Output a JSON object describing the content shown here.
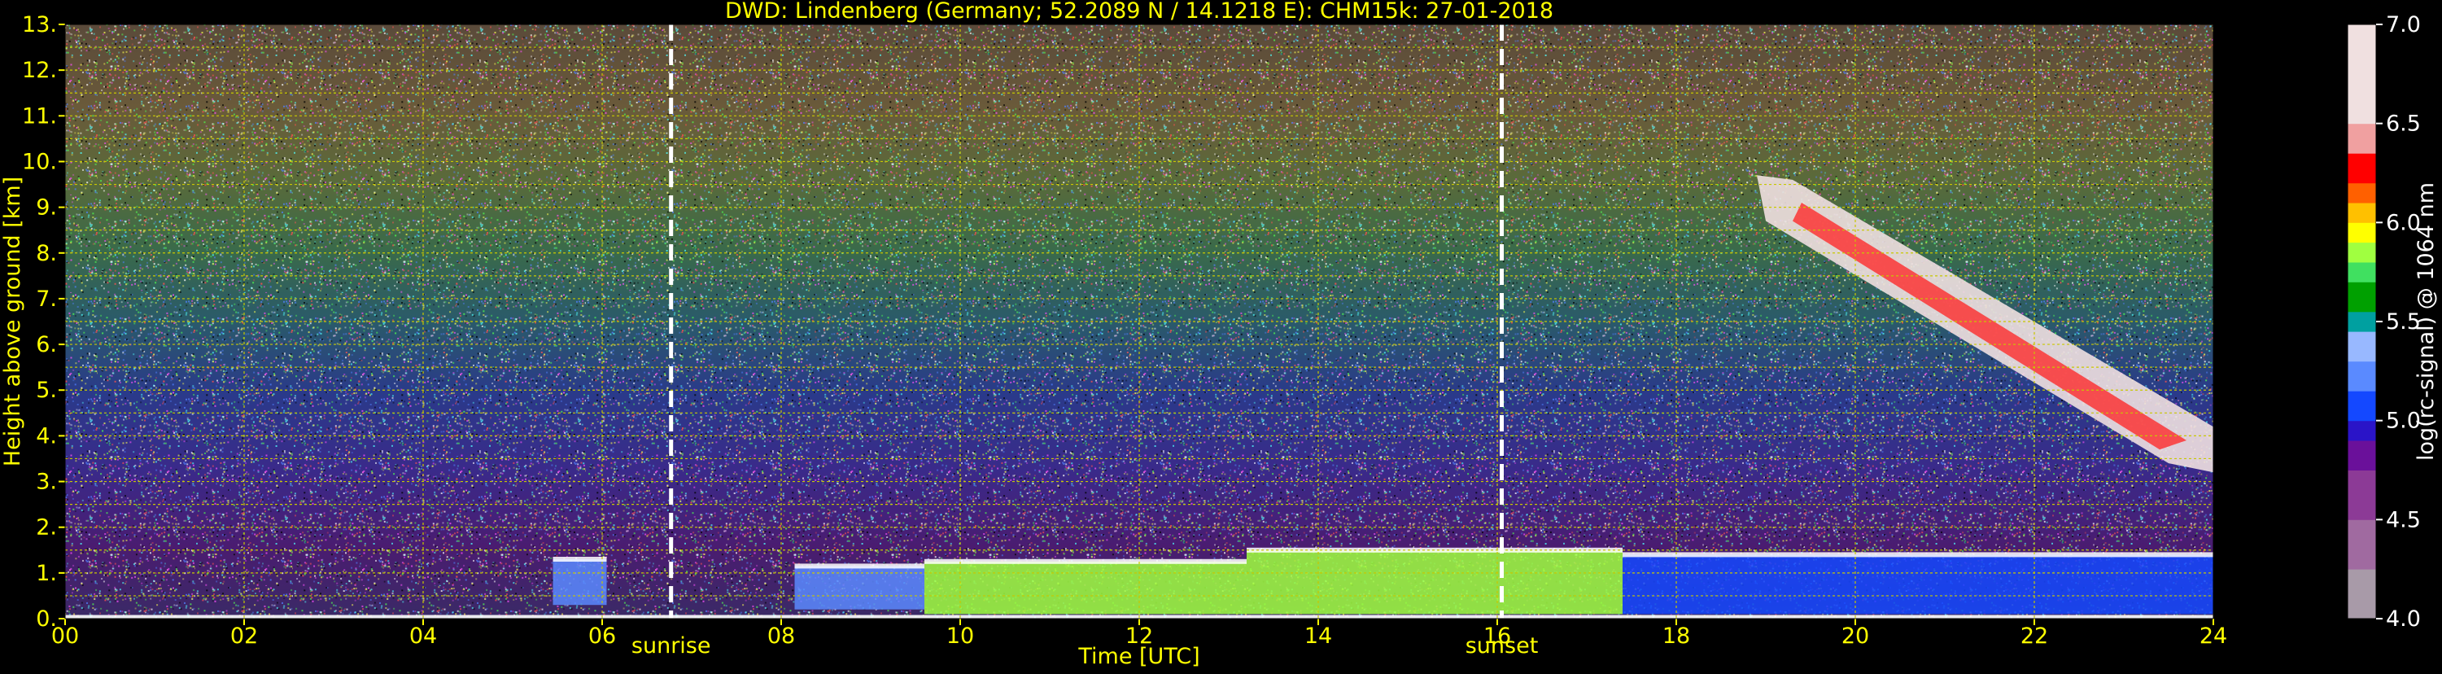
{
  "chart_data": {
    "type": "heatmap",
    "title": "DWD: Lindenberg (Germany; 52.2089 N / 14.1218 E):    CHM15k: 27-01-2018",
    "xlabel": "Time [UTC]",
    "ylabel": "Height above ground [km]",
    "colorbar_label": "log(rc-signal) @ 1064 nm",
    "xlim": [
      0,
      24
    ],
    "ylim": [
      0,
      13
    ],
    "clim": [
      4.0,
      7.0
    ],
    "x_ticks": [
      0,
      2,
      4,
      6,
      8,
      10,
      12,
      14,
      16,
      18,
      20,
      22,
      24
    ],
    "x_tick_labels": [
      "00",
      "02",
      "04",
      "06",
      "08",
      "10",
      "12",
      "14",
      "16",
      "18",
      "20",
      "22",
      "24"
    ],
    "y_ticks": [
      0,
      1,
      2,
      3,
      4,
      5,
      6,
      7,
      8,
      9,
      10,
      11,
      12,
      13
    ],
    "y_tick_labels": [
      "0.",
      "1.",
      "2.",
      "3.",
      "4.",
      "5.",
      "6.",
      "7.",
      "8.",
      "9.",
      "10.",
      "11.",
      "12.",
      "13."
    ],
    "colorbar_ticks": [
      4.0,
      4.5,
      5.0,
      5.5,
      6.0,
      6.5,
      7.0
    ],
    "colorbar_tick_labels": [
      "4.0",
      "4.5",
      "5.0",
      "5.5",
      "6.0",
      "6.5",
      "7.0"
    ],
    "grid": true,
    "annotations": [
      {
        "label": "sunrise",
        "time": 6.77
      },
      {
        "label": "sunset",
        "time": 16.05
      }
    ],
    "features": [
      {
        "time_start": 5.45,
        "time_end": 6.05,
        "height_bottom": 0.3,
        "height_top": 1.3,
        "value": 5.2
      },
      {
        "time_start": 8.15,
        "time_end": 9.6,
        "height_bottom": 0.2,
        "height_top": 1.15,
        "value": 5.2
      },
      {
        "time_start": 9.6,
        "time_end": 13.2,
        "height_bottom": 0.1,
        "height_top": 1.25,
        "value": 5.8
      },
      {
        "time_start": 13.2,
        "time_end": 17.4,
        "height_bottom": 0.1,
        "height_top": 1.5,
        "value": 5.8
      },
      {
        "time_start": 17.4,
        "time_end": 24.0,
        "height_bottom": 0.1,
        "height_top": 1.4,
        "value": 5.1
      },
      {
        "time_start": 18.9,
        "time_end": 24.0,
        "height_bottom": 3.2,
        "height_top": 9.7,
        "value": 6.6,
        "note": "descending cirrus layer"
      }
    ]
  },
  "colors": {
    "background": "#000000",
    "text": "#ffff00",
    "grid": "#c8c800",
    "markers": "#ffffff"
  },
  "colormap": [
    {
      "value": 4.0,
      "color": "#a89aa8"
    },
    {
      "value": 4.25,
      "color": "#a06aa0"
    },
    {
      "value": 4.5,
      "color": "#8c3a96"
    },
    {
      "value": 4.75,
      "color": "#6a109a"
    },
    {
      "value": 4.9,
      "color": "#2a14c8"
    },
    {
      "value": 5.0,
      "color": "#1448ff"
    },
    {
      "value": 5.15,
      "color": "#5a8aff"
    },
    {
      "value": 5.3,
      "color": "#98b8ff"
    },
    {
      "value": 5.45,
      "color": "#00a0a0"
    },
    {
      "value": 5.55,
      "color": "#00a000"
    },
    {
      "value": 5.7,
      "color": "#40e060"
    },
    {
      "value": 5.8,
      "color": "#a0ff40"
    },
    {
      "value": 5.9,
      "color": "#ffff00"
    },
    {
      "value": 6.0,
      "color": "#ffc000"
    },
    {
      "value": 6.1,
      "color": "#ff6000"
    },
    {
      "value": 6.2,
      "color": "#ff0000"
    },
    {
      "value": 6.35,
      "color": "#f0a0a0"
    },
    {
      "value": 6.5,
      "color": "#f0e0e0"
    },
    {
      "value": 7.0,
      "color": "#ffffff"
    }
  ]
}
